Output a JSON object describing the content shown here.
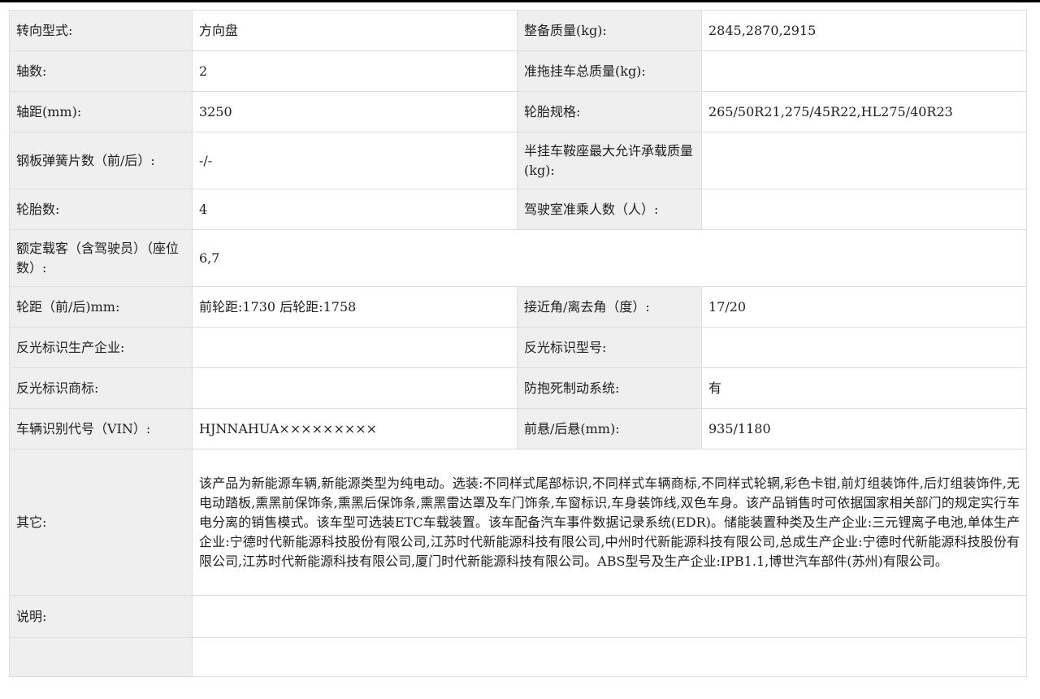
{
  "rows": {
    "r1": {
      "l1": "转向型式:",
      "v1": "方向盘",
      "l2": "整备质量(kg):",
      "v2": "2845,2870,2915"
    },
    "r2": {
      "l1": "轴数:",
      "v1": "2",
      "l2": "准拖挂车总质量(kg):",
      "v2": ""
    },
    "r3": {
      "l1": "轴距(mm):",
      "v1": "3250",
      "l2": "轮胎规格:",
      "v2": "265/50R21,275/45R22,HL275/40R23"
    },
    "r4": {
      "l1": "钢板弹簧片数（前/后）:",
      "v1": "-/-",
      "l2": "半挂车鞍座最大允许承载质量(kg):",
      "v2": ""
    },
    "r5": {
      "l1": "轮胎数:",
      "v1": "4",
      "l2": "驾驶室准乘人数（人）:",
      "v2": ""
    },
    "r6": {
      "l1": "额定载客（含驾驶员）（座位数）:",
      "v1": "6,7"
    },
    "r7": {
      "l1": "轮距（前/后)mm:",
      "v1": "前轮距:1730 后轮距:1758",
      "l2": "接近角/离去角（度）:",
      "v2": "17/20"
    },
    "r8": {
      "l1": "反光标识生产企业:",
      "v1": "",
      "l2": "反光标识型号:",
      "v2": ""
    },
    "r9": {
      "l1": "反光标识商标:",
      "v1": "",
      "l2": "防抱死制动系统:",
      "v2": "有"
    },
    "r10": {
      "l1": "车辆识别代号（VIN）:",
      "v1": "HJNNAHUA×××××××××",
      "l2": "前悬/后悬(mm):",
      "v2": "935/1180"
    },
    "other": {
      "label": "其它:",
      "value": "该产品为新能源车辆,新能源类型为纯电动。选装:不同样式尾部标识,不同样式车辆商标,不同样式轮辋,彩色卡钳,前灯组装饰件,后灯组装饰件,无电动踏板,熏黑前保饰条,熏黑后保饰条,熏黑雷达罩及车门饰条,车窗标识,车身装饰线,双色车身。该产品销售时可依据国家相关部门的规定实行车电分离的销售模式。该车型可选装ETC车载装置。该车配备汽车事件数据记录系统(EDR)。储能装置种类及生产企业:三元锂离子电池,单体生产企业:宁德时代新能源科技股份有限公司,江苏时代新能源科技有限公司,中州时代新能源科技有限公司,总成生产企业:宁德时代新能源科技股份有限公司,江苏时代新能源科技有限公司,厦门时代新能源科技有限公司。ABS型号及生产企业:IPB1.1,博世汽车部件(苏州)有限公司。"
    },
    "note": {
      "label": "说明:",
      "value": ""
    },
    "last": {
      "label": "",
      "value": ""
    }
  }
}
